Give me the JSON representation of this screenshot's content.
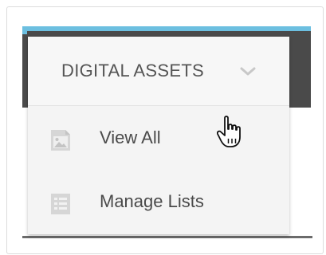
{
  "menu": {
    "title": "DIGITAL ASSETS",
    "items": [
      {
        "label": "View All",
        "icon": "image-icon"
      },
      {
        "label": "Manage Lists",
        "icon": "list-icon"
      }
    ]
  },
  "colors": {
    "accent": "#6cbfe0",
    "header_bar": "#4a4a4a",
    "text": "#4a4a4a",
    "icon": "#bdbdbd"
  }
}
